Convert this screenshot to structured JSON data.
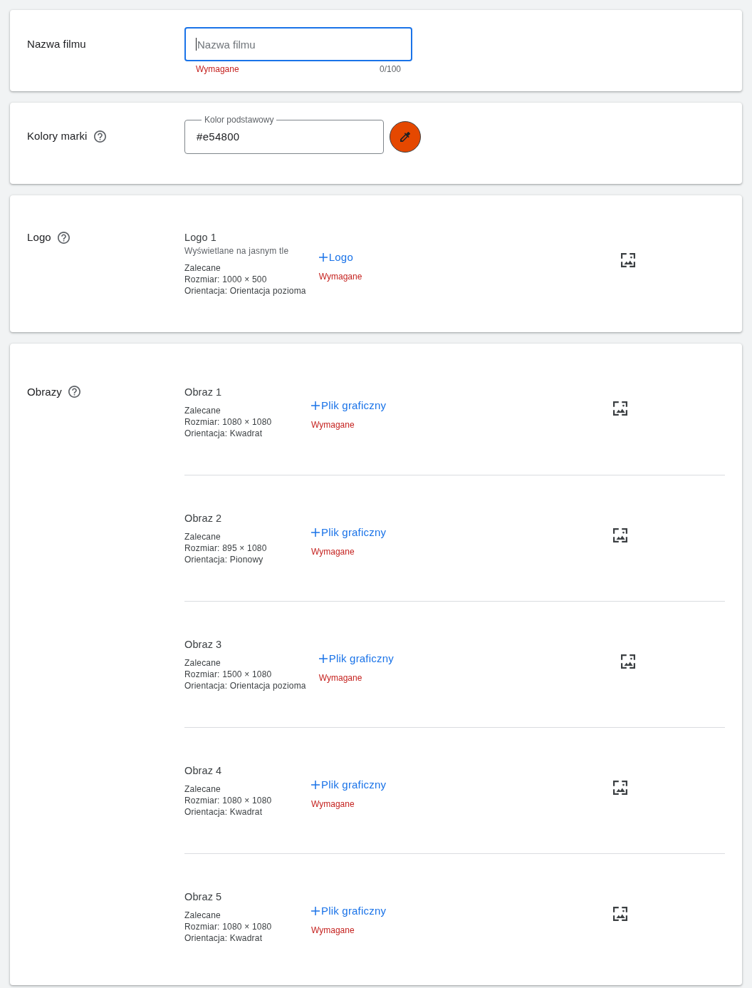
{
  "sections": [
    {
      "kind": "text_field",
      "label": "Nazwa filmu",
      "help": false,
      "field": {
        "placeholder": "Nazwa filmu",
        "focused": true
      },
      "hint": "Wymagane",
      "counter": "0/100"
    },
    {
      "kind": "color",
      "label": "Kolory marki",
      "help": true,
      "field": {
        "label": "Kolor podstawowy",
        "value": "#e54800"
      },
      "picker": {
        "color": "#e54800"
      }
    },
    {
      "kind": "assets",
      "label": "Logo",
      "help": true,
      "items": [
        {
          "title": "Logo 1",
          "subtitle": "Wyświetlane na jasnym tle",
          "recommended": "Zalecane",
          "size": "Rozmiar: 1000 × 500",
          "orientation": "Orientacja: Orientacja pozioma",
          "button": "Logo",
          "required": "Wymagane"
        }
      ]
    },
    {
      "kind": "assets",
      "label": "Obrazy",
      "help": true,
      "items": [
        {
          "title": "Obraz 1",
          "recommended": "Zalecane",
          "size": "Rozmiar: 1080 × 1080",
          "orientation": "Orientacja: Kwadrat",
          "button": "Plik graficzny",
          "required": "Wymagane"
        },
        {
          "title": "Obraz 2",
          "recommended": "Zalecane",
          "size": "Rozmiar: 895 × 1080",
          "orientation": "Orientacja: Pionowy",
          "button": "Plik graficzny",
          "required": "Wymagane"
        },
        {
          "title": "Obraz 3",
          "recommended": "Zalecane",
          "size": "Rozmiar: 1500 × 1080",
          "orientation": "Orientacja: Orientacja pozioma",
          "button": "Plik graficzny",
          "required": "Wymagane"
        },
        {
          "title": "Obraz 4",
          "recommended": "Zalecane",
          "size": "Rozmiar: 1080 × 1080",
          "orientation": "Orientacja: Kwadrat",
          "button": "Plik graficzny",
          "required": "Wymagane"
        },
        {
          "title": "Obraz 5",
          "recommended": "Zalecane",
          "size": "Rozmiar: 1080 × 1080",
          "orientation": "Orientacja: Kwadrat",
          "button": "Plik graficzny",
          "required": "Wymagane"
        }
      ]
    }
  ]
}
